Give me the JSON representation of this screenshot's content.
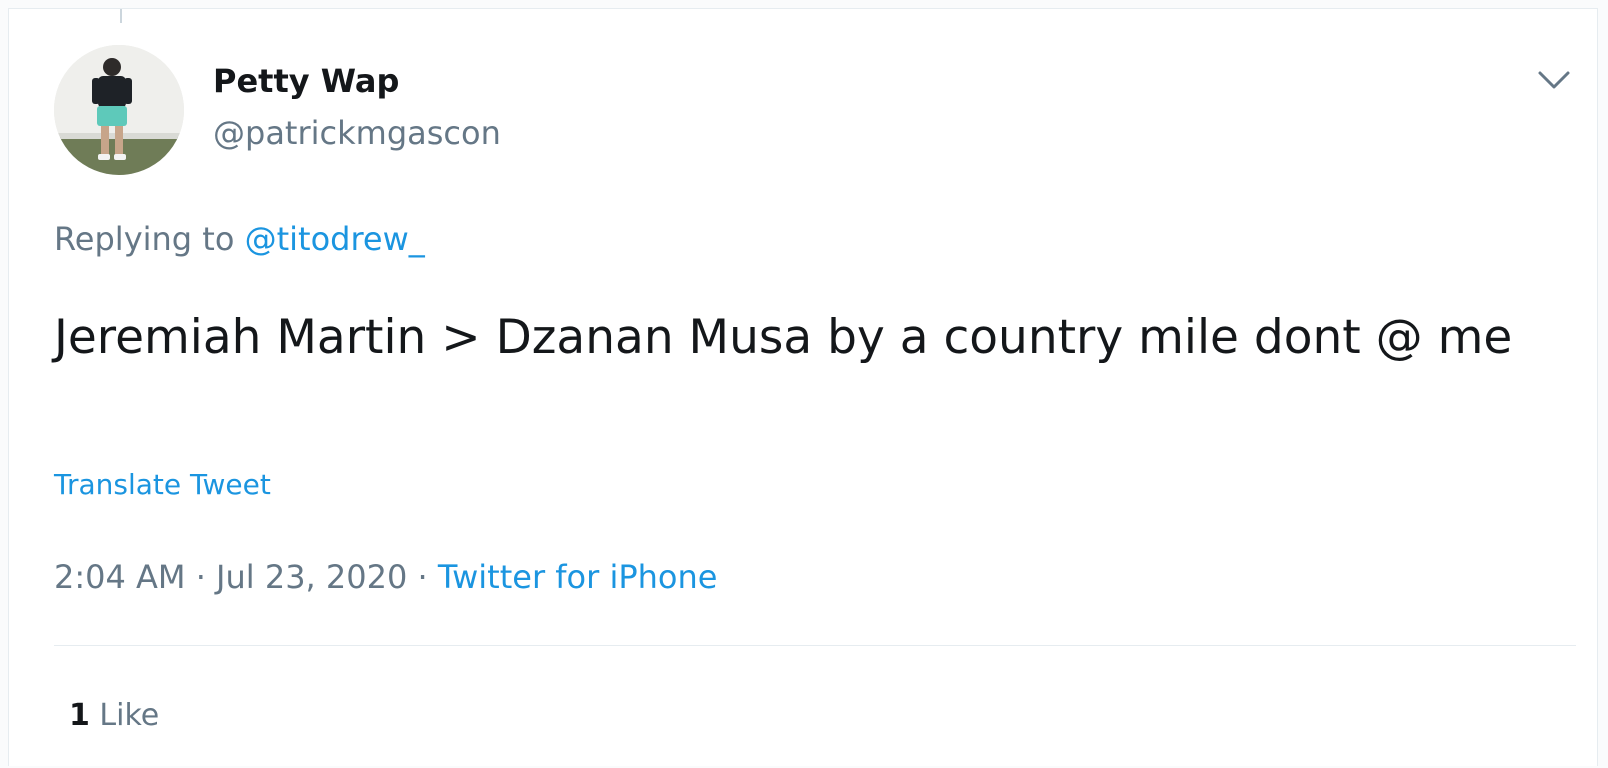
{
  "tweet": {
    "author": {
      "display_name": "Petty Wap",
      "handle": "@patrickmgascon"
    },
    "replying_prefix": "Replying to",
    "replying_to": "@titodrew_",
    "text": "Jeremiah Martin > Dzanan Musa by a country mile dont @ me",
    "translate_label": "Translate Tweet",
    "time": "2:04 AM",
    "separator": "·",
    "date": "Jul 23, 2020",
    "source": "Twitter for iPhone",
    "like_count": "1",
    "like_label": "Like"
  },
  "icons": {
    "more": "chevron-down-icon",
    "avatar": "avatar"
  },
  "colors": {
    "link": "#1b95e0",
    "secondary_text": "#657786",
    "primary_text": "#14171a",
    "border": "#e6ecf0"
  }
}
